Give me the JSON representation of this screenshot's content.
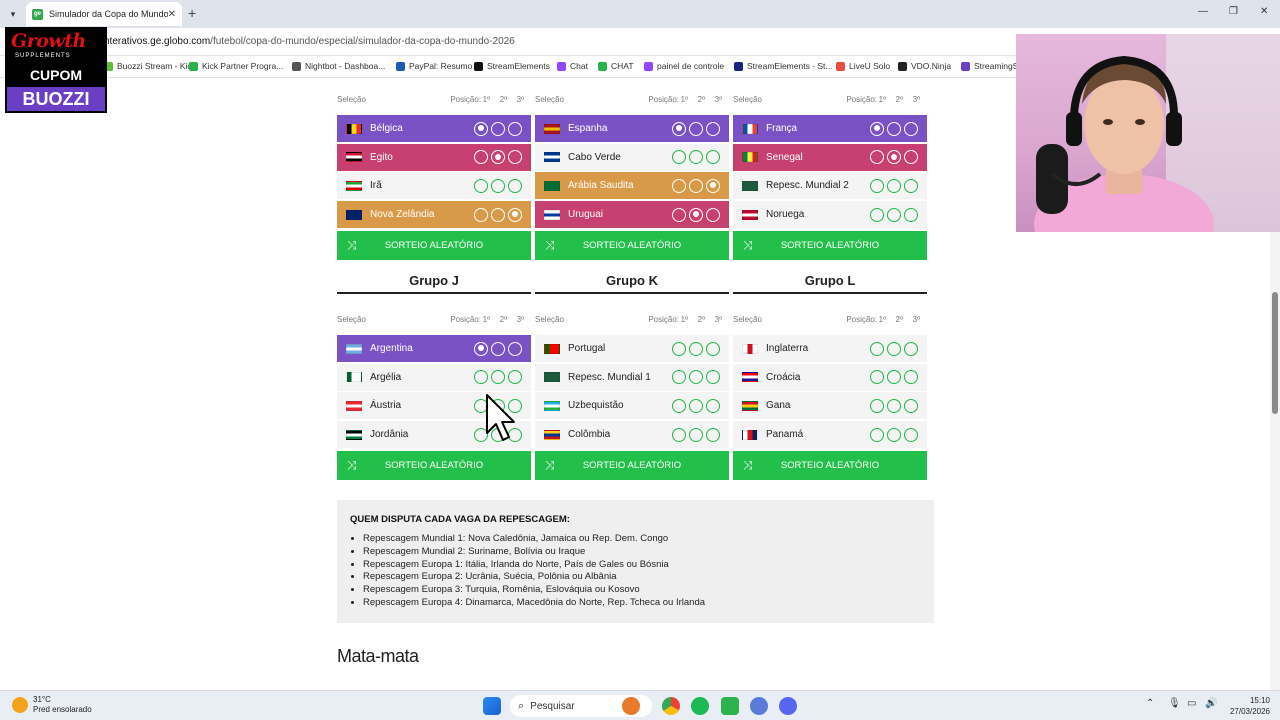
{
  "browser": {
    "tab_title": "Simulador da Copa do Mundo",
    "tab_favicon": "ge",
    "url_prefix": "nterativos.ge.globo.com",
    "url_path": "/futebol/copa-do-mundo/especial/simulador-da-copa-do-mundo-2026",
    "bookmarks": [
      {
        "label": "Buozzi Stream - Kic...",
        "color": "#5bc236"
      },
      {
        "label": "Kick Partner Progra...",
        "color": "#2bb24c"
      },
      {
        "label": "Nightbot - Dashboa...",
        "color": "#555555"
      },
      {
        "label": "PayPal: Resumo",
        "color": "#1e5bb8"
      },
      {
        "label": "StreamElements",
        "color": "#111111"
      },
      {
        "label": "Chat",
        "color": "#9146ff"
      },
      {
        "label": "CHAT",
        "color": "#2bb24c"
      },
      {
        "label": "painel de controle",
        "color": "#9146ff"
      },
      {
        "label": "StreamElements - St...",
        "color": "#1a237e"
      },
      {
        "label": "LiveU Solo",
        "color": "#e74c3c"
      },
      {
        "label": "VDO.Ninja",
        "color": "#222222"
      },
      {
        "label": "StreamingS",
        "color": "#6a3fc4"
      }
    ]
  },
  "promo": {
    "brand": "Growth",
    "brand_sub": "SUPPLEMENTS",
    "line1": "CUPOM",
    "line2": "BUOZZI"
  },
  "header_labels": {
    "selecao": "Seleção",
    "posicao": "Posição:",
    "p1": "1º",
    "p2": "2º",
    "p3": "3º"
  },
  "upper_groups": [
    {
      "teams": [
        {
          "name": "Bélgica",
          "style": "purple",
          "selected": 1,
          "flag": [
            "#000000",
            "#f9d616",
            "#ed2939"
          ],
          "flag_dir": "v"
        },
        {
          "name": "Egito",
          "style": "pink",
          "selected": 2,
          "flag": [
            "#ce1126",
            "#ffffff",
            "#000000"
          ],
          "flag_dir": "h"
        },
        {
          "name": "Irã",
          "style": "",
          "selected": 0,
          "flag": [
            "#239f40",
            "#ffffff",
            "#da0000"
          ],
          "flag_dir": "h"
        },
        {
          "name": "Nova Zelândia",
          "style": "orange",
          "selected": 3,
          "flag": [
            "#012169",
            "#012169",
            "#012169"
          ],
          "flag_dir": "h"
        }
      ]
    },
    {
      "teams": [
        {
          "name": "Espanha",
          "style": "purple",
          "selected": 1,
          "flag": [
            "#aa151b",
            "#f1bf00",
            "#aa151b"
          ],
          "flag_dir": "h"
        },
        {
          "name": "Cabo Verde",
          "style": "",
          "selected": 0,
          "flag": [
            "#003893",
            "#ffffff",
            "#003893"
          ],
          "flag_dir": "h"
        },
        {
          "name": "Arábia Saudita",
          "style": "orange",
          "selected": 3,
          "flag": [
            "#006c35",
            "#006c35",
            "#006c35"
          ],
          "flag_dir": "h"
        },
        {
          "name": "Uruguai",
          "style": "pink",
          "selected": 2,
          "flag": [
            "#ffffff",
            "#0038a8",
            "#ffffff"
          ],
          "flag_dir": "h"
        }
      ]
    },
    {
      "teams": [
        {
          "name": "França",
          "style": "purple",
          "selected": 1,
          "flag": [
            "#0055a4",
            "#ffffff",
            "#ef4135"
          ],
          "flag_dir": "v"
        },
        {
          "name": "Senegal",
          "style": "pink",
          "selected": 2,
          "flag": [
            "#00853f",
            "#fdef42",
            "#e31b23"
          ],
          "flag_dir": "v"
        },
        {
          "name": "Repesc. Mundial 2",
          "style": "",
          "selected": 0,
          "flag": [
            "#1e5b3e",
            "#1e5b3e",
            "#1e5b3e"
          ],
          "flag_dir": "h"
        },
        {
          "name": "Noruega",
          "style": "",
          "selected": 0,
          "flag": [
            "#ba0c2f",
            "#ffffff",
            "#ba0c2f"
          ],
          "flag_dir": "h"
        }
      ]
    }
  ],
  "random_label": "SORTEIO ALEATÓRIO",
  "lower_groups": [
    {
      "title": "Grupo J",
      "teams": [
        {
          "name": "Argentina",
          "style": "purple",
          "selected": 1,
          "flag": [
            "#74acdf",
            "#ffffff",
            "#74acdf"
          ],
          "flag_dir": "h"
        },
        {
          "name": "Argélia",
          "style": "",
          "selected": 0,
          "flag": [
            "#006233",
            "#ffffff",
            "#ffffff"
          ],
          "flag_dir": "v"
        },
        {
          "name": "Áustria",
          "style": "",
          "selected": 0,
          "flag": [
            "#ed2939",
            "#ffffff",
            "#ed2939"
          ],
          "flag_dir": "h"
        },
        {
          "name": "Jordânia",
          "style": "",
          "selected": 0,
          "flag": [
            "#000000",
            "#ffffff",
            "#007a3d"
          ],
          "flag_dir": "h"
        }
      ]
    },
    {
      "title": "Grupo K",
      "teams": [
        {
          "name": "Portugal",
          "style": "",
          "selected": 0,
          "flag": [
            "#006600",
            "#ff0000",
            "#ff0000"
          ],
          "flag_dir": "v"
        },
        {
          "name": "Repesc. Mundial 1",
          "style": "",
          "selected": 0,
          "flag": [
            "#1e5b3e",
            "#1e5b3e",
            "#1e5b3e"
          ],
          "flag_dir": "h"
        },
        {
          "name": "Uzbequistão",
          "style": "",
          "selected": 0,
          "flag": [
            "#1eb5e6",
            "#ffffff",
            "#1eb53a"
          ],
          "flag_dir": "h"
        },
        {
          "name": "Colômbia",
          "style": "",
          "selected": 0,
          "flag": [
            "#fcd116",
            "#003893",
            "#ce1126"
          ],
          "flag_dir": "h"
        }
      ]
    },
    {
      "title": "Grupo L",
      "teams": [
        {
          "name": "Inglaterra",
          "style": "",
          "selected": 0,
          "flag": [
            "#ffffff",
            "#ce1124",
            "#ffffff"
          ],
          "flag_dir": "v"
        },
        {
          "name": "Croácia",
          "style": "",
          "selected": 0,
          "flag": [
            "#ff0000",
            "#ffffff",
            "#171796"
          ],
          "flag_dir": "h"
        },
        {
          "name": "Gana",
          "style": "",
          "selected": 0,
          "flag": [
            "#ce1126",
            "#fcd116",
            "#006b3f"
          ],
          "flag_dir": "h"
        },
        {
          "name": "Panamá",
          "style": "",
          "selected": 0,
          "flag": [
            "#ffffff",
            "#da121a",
            "#072357"
          ],
          "flag_dir": "v"
        }
      ]
    }
  ],
  "repescagem": {
    "title": "QUEM DISPUTA CADA VAGA DA REPESCAGEM:",
    "items": [
      "Repescagem Mundial 1: Nova Caledônia, Jamaica ou Rep. Dem. Congo",
      "Repescagem Mundial 2: Suriname, Bolívia ou Iraque",
      "Repescagem Europa 1: Itália, Irlanda do Norte, País de Gales ou Bósnia",
      "Repescagem Europa 2: Ucrânia, Suécia, Polônia ou Albânia",
      "Repescagem Europa 3: Turquia, Romênia, Eslováquia ou Kosovo",
      "Repescagem Europa 4: Dinamarca, Macedônia do Norte, Rep. Tcheca ou Irlanda"
    ]
  },
  "mata_title": "Mata-mata",
  "taskbar": {
    "temp": "31°C",
    "weather": "Pred ensolarado",
    "search": "Pesquisar",
    "time": "15:10",
    "date": "27/03/2026"
  }
}
